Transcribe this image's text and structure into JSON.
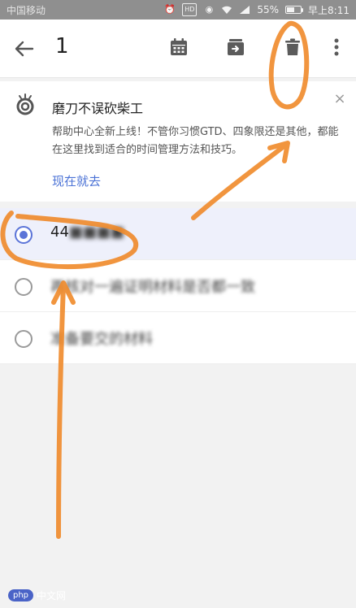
{
  "status_bar": {
    "carrier": "中国移动",
    "battery_percent": 55,
    "battery_text": "55%",
    "time": "早上8:11",
    "hd_label": "HD",
    "icons": [
      "alarm-icon",
      "hd-icon",
      "eye-icon",
      "wifi-icon",
      "signal-icon",
      "battery-icon"
    ]
  },
  "toolbar": {
    "title": "1",
    "icons": [
      "back-arrow-icon",
      "calendar-icon",
      "move-icon",
      "delete-icon",
      "more-icon"
    ]
  },
  "help_card": {
    "title": "磨刀不误砍柴工",
    "body": "帮助中心全新上线！不管你习惯GTD、四象限还是其他，都能在这里找到适合的时间管理方法和技巧。",
    "link": "现在就去",
    "close": "×"
  },
  "tasks": [
    {
      "visible": "44",
      "blurred": "■■■■",
      "selected": true
    },
    {
      "visible": "再核对一遍证明材料是否都一致",
      "blurred": "",
      "selected": false
    },
    {
      "visible": "准备要交的材料",
      "blurred": "",
      "selected": false
    }
  ],
  "watermark": {
    "badge": "php",
    "text": "中文网"
  },
  "colors": {
    "accent": "#5b74d8",
    "link": "#4c73d6",
    "annotation": "#f08a2a",
    "status_bar": "#8f8f8f"
  }
}
